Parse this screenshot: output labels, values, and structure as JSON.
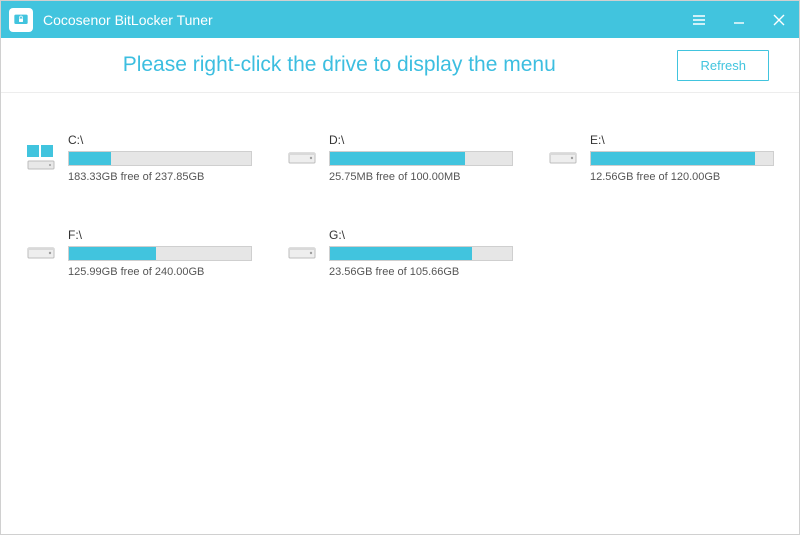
{
  "colors": {
    "accent": "#41c4de"
  },
  "titlebar": {
    "app_name": "Cocosenor BitLocker Tuner"
  },
  "subheader": {
    "instruction": "Please right-click the drive to display the menu",
    "refresh_label": "Refresh"
  },
  "drives": [
    {
      "label": "C:\\",
      "status": "183.33GB free of 237.85GB",
      "used_pct": 23,
      "os": true
    },
    {
      "label": "D:\\",
      "status": "25.75MB free of 100.00MB",
      "used_pct": 74,
      "os": false
    },
    {
      "label": "E:\\",
      "status": "12.56GB free of 120.00GB",
      "used_pct": 90,
      "os": false
    },
    {
      "label": "F:\\",
      "status": "125.99GB free of 240.00GB",
      "used_pct": 48,
      "os": false
    },
    {
      "label": "G:\\",
      "status": "23.56GB free of 105.66GB",
      "used_pct": 78,
      "os": false
    }
  ]
}
